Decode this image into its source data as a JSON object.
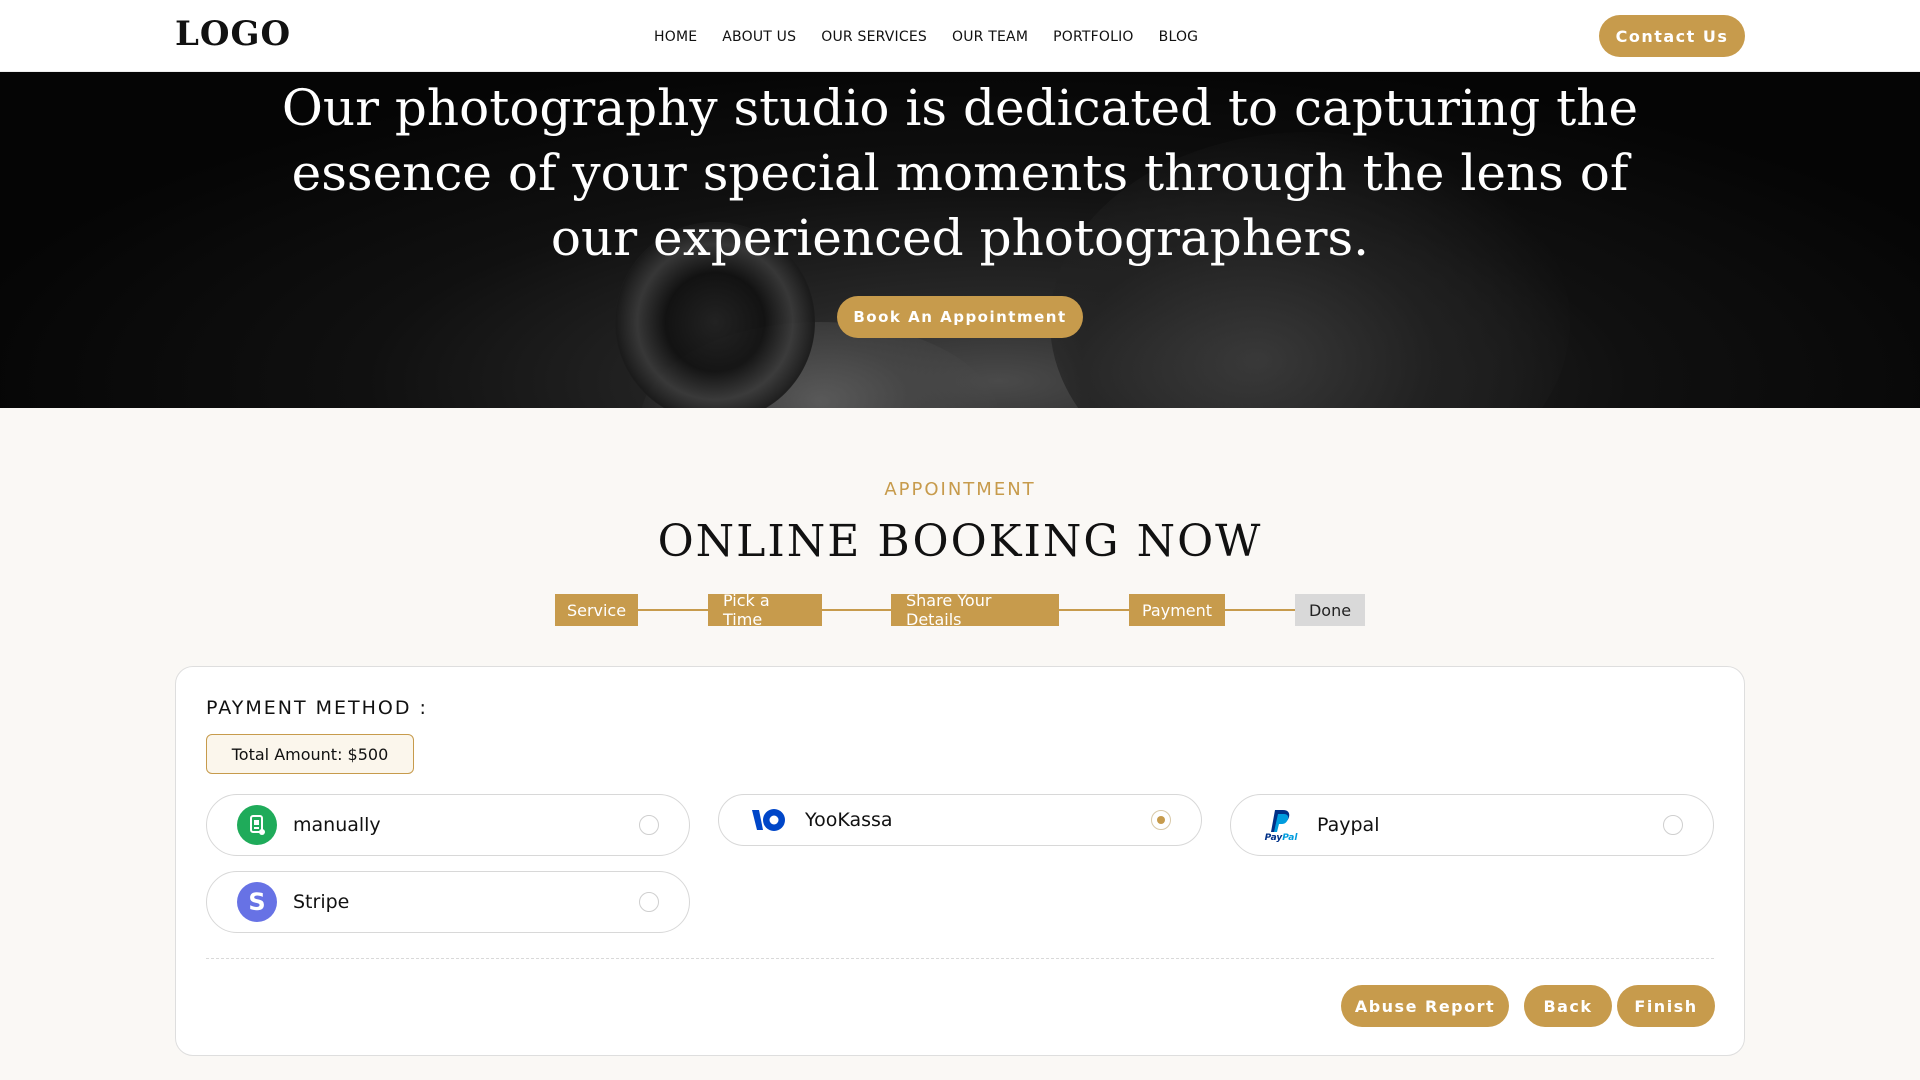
{
  "header": {
    "logo": "LOGO",
    "nav": [
      "HOME",
      "ABOUT US",
      "OUR SERVICES",
      "OUR TEAM",
      "PORTFOLIO",
      "BLOG"
    ],
    "contact_label": "Contact Us"
  },
  "hero": {
    "title": "Our photography studio is dedicated to capturing the essence of your special moments through the lens of our experienced photographers.",
    "cta_label": "Book An Appointment"
  },
  "booking": {
    "kicker": "APPOINTMENT",
    "title": "ONLINE BOOKING NOW",
    "steps": [
      {
        "label": "Service",
        "status": "complete"
      },
      {
        "label": "Pick a Time",
        "status": "complete"
      },
      {
        "label": "Share Your Details",
        "status": "complete"
      },
      {
        "label": "Payment",
        "status": "current"
      },
      {
        "label": "Done",
        "status": "pending"
      }
    ]
  },
  "payment": {
    "title": "PAYMENT METHOD :",
    "total": "Total Amount: $500",
    "options": [
      {
        "label": "manually",
        "icon": "manual-payment-icon",
        "selected": false
      },
      {
        "label": "YooKassa",
        "icon": "yookassa-icon",
        "selected": true
      },
      {
        "label": "Paypal",
        "icon": "paypal-icon",
        "selected": false
      },
      {
        "label": "Stripe",
        "icon": "stripe-icon",
        "selected": false
      }
    ],
    "buttons": {
      "abuse": "Abuse Report",
      "back": "Back",
      "finish": "Finish"
    }
  },
  "colors": {
    "accent": "#c79b4c",
    "step_inactive": "#d9d9d9",
    "stripe": "#6772e5",
    "manual": "#1fab5a",
    "yookassa": "#0046c8",
    "paypal_dark": "#003087",
    "paypal_light": "#009cde"
  }
}
